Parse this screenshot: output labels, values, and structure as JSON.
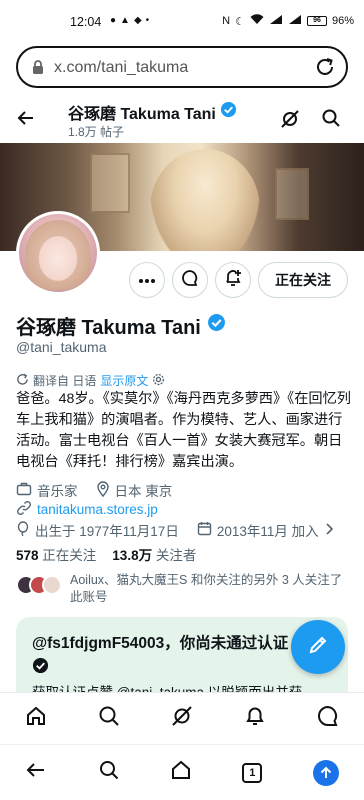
{
  "status_bar": {
    "time": "12:04",
    "battery": "96%"
  },
  "browser": {
    "url": "x.com/tani_takuma"
  },
  "header": {
    "name": "谷琢磨 Takuma Tani",
    "posts": "1.8万 帖子"
  },
  "profile": {
    "name": "谷琢磨 Takuma Tani",
    "handle": "@tani_takuma",
    "follow_button": "正在关注",
    "translate_label": "翻译自 日语",
    "show_original": "显示原文",
    "bio": "爸爸。48岁。《实莫尔》《海丹西克多萝西》《在回忆列车上我和猫》的演唱者。作为模特、艺人、画家进行活动。富士电视台《百人一首》女装大赛冠军。朝日电视台《拜托！排行榜》嘉宾出演。",
    "profession": "音乐家",
    "location": "日本 東京",
    "website": "tanitakuma.stores.jp",
    "birth": "出生于 1977年11月17日",
    "joined": "2013年11月 加入",
    "following_count": "578",
    "following_label": "正在关注",
    "followers_count": "13.8万",
    "followers_label": "关注者",
    "known_followers": "Aoilux、猫丸大魔王S 和你关注的另外 3 人关注了此账号"
  },
  "verify_card": {
    "title": "@fs1fdjgmF54003，你尚未通过认证",
    "body": "获取认证点赞 @tani_takuma 以脱颖而出并获"
  },
  "colors": {
    "accent": "#1d9bf0",
    "card_bg": "#e5f4ea",
    "text_secondary": "#536471"
  },
  "bottom_nav": [
    "home-icon",
    "search-icon",
    "grok-icon",
    "notifications-icon",
    "messages-icon"
  ],
  "system_nav": {
    "tabs_count": "1"
  }
}
